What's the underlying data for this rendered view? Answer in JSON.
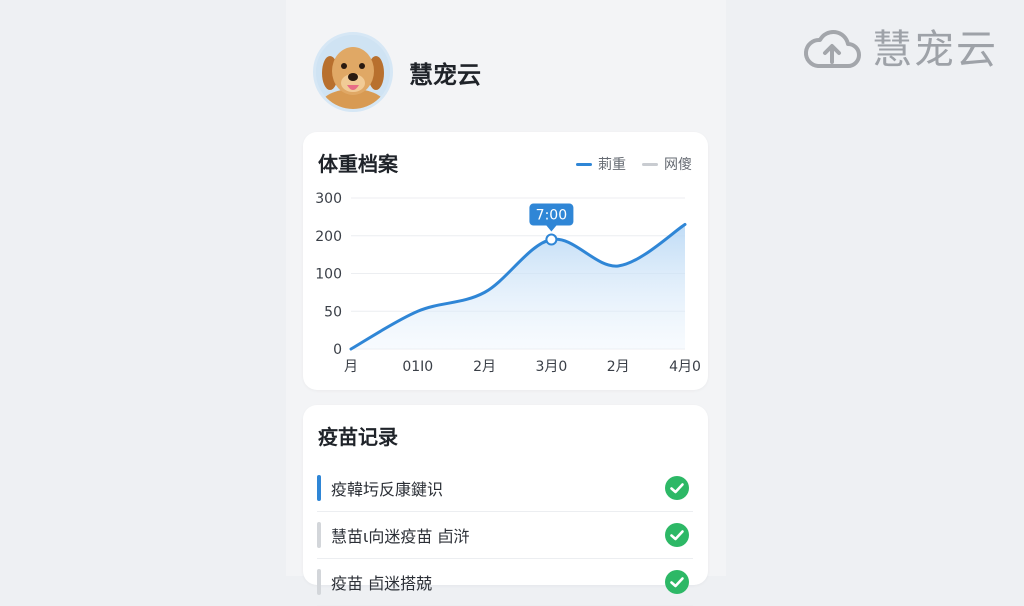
{
  "app": {
    "brand": "慧宠云",
    "brand_icon": "cloud-upload-icon",
    "pet_name": "慧宠云"
  },
  "weight": {
    "title": "体重档案",
    "legend": [
      {
        "label": "莿重",
        "color": "#2f86d6"
      },
      {
        "label": "网傻",
        "color": "#c9ccd1"
      }
    ]
  },
  "chart_data": {
    "type": "area",
    "categories": [
      "月",
      "01I0",
      "2月",
      "3月0",
      "2月",
      "4月0"
    ],
    "yticks": [
      0,
      50,
      100,
      200,
      300
    ],
    "values": [
      0,
      50,
      75,
      190,
      120,
      230
    ],
    "ylim": [
      0,
      300
    ],
    "tooltip": {
      "label": "7:00",
      "index": 3
    },
    "grid": true,
    "legend_position": "top-right"
  },
  "vaccine": {
    "title": "疫苗记录",
    "items": [
      {
        "label": "疫韓圬反康鍵识",
        "bar_color": "#2f86d6",
        "done": true
      },
      {
        "label": "慧苗ι向迷疫苗 卣浒",
        "bar_color": "#d3d6da",
        "done": true
      },
      {
        "label": "疫苗 卣迷搭兢",
        "bar_color": "#d3d6da",
        "done": true
      }
    ],
    "check_color": "#2db866"
  }
}
